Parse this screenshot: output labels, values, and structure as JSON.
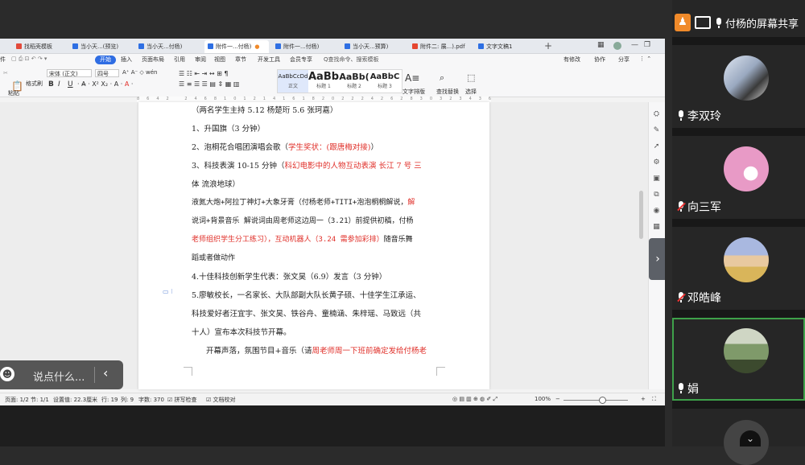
{
  "tabs": [
    {
      "label": "找稻壳模板",
      "icon": "red"
    },
    {
      "label": "当小天...(预览)",
      "icon": "wd"
    },
    {
      "label": "当小天...付杨)",
      "icon": "wd"
    },
    {
      "label": "附件一...付杨)",
      "icon": "wd",
      "active": true
    },
    {
      "label": "附件一...付杨)",
      "icon": "wd"
    },
    {
      "label": "当小天...预算)",
      "icon": "wd"
    },
    {
      "label": "附件二: 展...).pdf",
      "icon": "pdf"
    },
    {
      "label": "文字文稿1",
      "icon": "wd"
    }
  ],
  "menu": {
    "file": "件",
    "start": "开始",
    "items": [
      "插入",
      "页面布局",
      "引用",
      "审阅",
      "视图",
      "章节",
      "开发工具",
      "会员专享"
    ],
    "search": "Q查找命令、搜索模板",
    "right": [
      "有修改",
      "协作",
      "分享"
    ]
  },
  "toolbar": {
    "paste": "粘贴",
    "format_brush": "格式刷",
    "font_name": "宋体 (正文)",
    "font_size": "四号",
    "styles": [
      {
        "sample": "AaBbCcDd",
        "label": "正文"
      },
      {
        "sample": "AaBb",
        "label": "标题 1"
      },
      {
        "sample": "AaBb(",
        "label": "标题 2"
      },
      {
        "sample": "AaBbC",
        "label": "标题 3"
      }
    ],
    "text_layout": "文字排版",
    "find_replace": "查找替换",
    "select": "选择"
  },
  "document": {
    "line0": "（两名学生主持   5.12  杨楚珩   5.6  张珂嘉）",
    "line1": "1、升国旗（3 分钟）",
    "line2a": "2、泡桐花合唱团演唱会歌（",
    "line2b": "学生奖状：(跟唐梅对接)",
    "line2c": "）",
    "line3a": "3、科技表演 10-15 分钟（",
    "line3b": "科幻电影中的人物互动表演   长江 7 号   三",
    "line4": "体  流浪地球）",
    "line5a": "液氮大炮+阿拉丁神灯+大象牙膏（付杨老师+TITI+泡泡桐桐解说，",
    "line5b": "解",
    "line6": "说词+背景音乐  解说词由周老师这边周一（3.21）前提供初稿，付杨",
    "line7": "老师组织学生分工练习），",
    "line7b": "互动机器人（3.24 需参加彩排）",
    "line7c": "随音乐舞",
    "line8": "蹈或者做动作",
    "line9": "4.十佳科技创新学生代表：张文昊（6.9）发言（3 分钟）",
    "line10": "5.廖敏校长，一名家长、大队部副大队长黄子硕、十佳学生江承运、",
    "line11": "科技爱好者汪宜宇、张文昊、铁谷舟、童楠涵、朱梓瑶、马致远（共",
    "line12": "十人）宣布本次科技节开幕。",
    "line13a": "开幕声落，氛围节目+音乐（请",
    "line13b": "周老师周一下班前确定发给付杨老"
  },
  "status": {
    "page": "页面: 1/2",
    "section": "节: 1/1",
    "setting": "设置值: 22.3厘米",
    "row": "行: 19",
    "col": "列: 9",
    "words": "字数: 370",
    "spell": "拼写检查",
    "proof": "文档校对",
    "zoom": "100%"
  },
  "chat": {
    "placeholder": "说点什么..."
  },
  "share": {
    "label": "付杨的屏幕共享"
  },
  "participants": [
    {
      "name": "李双玲",
      "mic": "on",
      "color": "#9aa9c0"
    },
    {
      "name": "向三军",
      "mic": "off",
      "color": "#e89ac6"
    },
    {
      "name": "邓皓峰",
      "mic": "off",
      "color": "#a9b8e0"
    },
    {
      "name": "娟",
      "mic": "on",
      "color": "#7f9a6a"
    }
  ]
}
